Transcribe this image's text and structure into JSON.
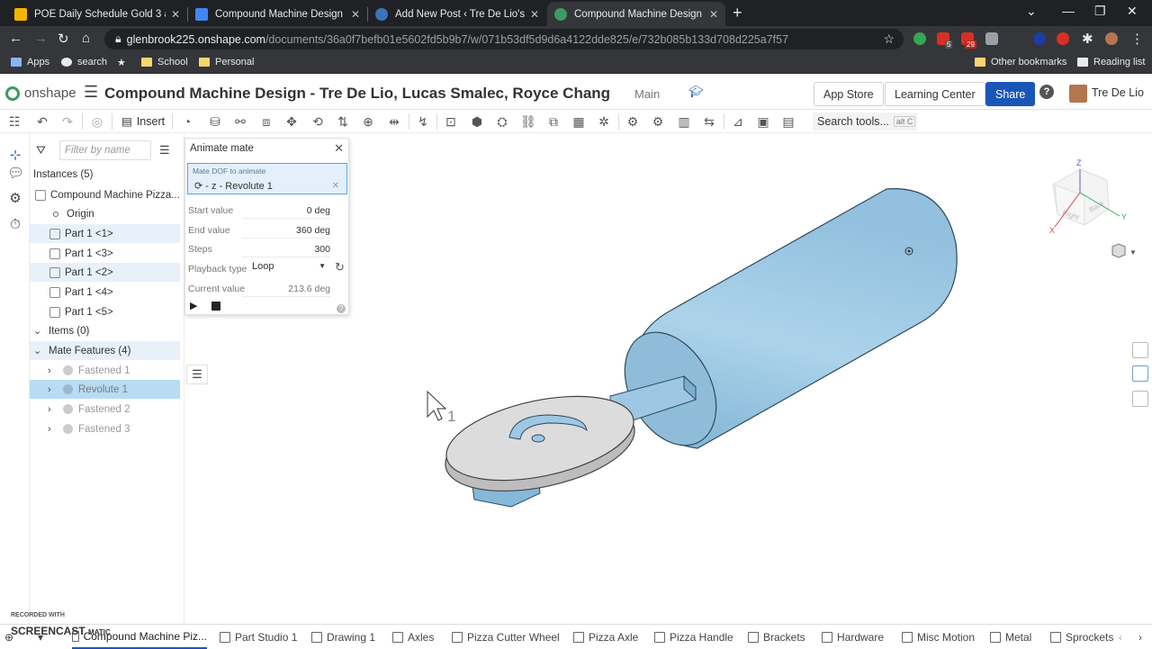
{
  "browser": {
    "tabs": [
      {
        "title": "POE Daily Schedule Gold 3 and C",
        "color": "#f4b400"
      },
      {
        "title": "Compound Machine Design with",
        "color": "#4285f4"
      },
      {
        "title": "Add New Post ‹ Tre De Lio's PLTW",
        "color": "#3b73b9"
      },
      {
        "title": "Compound Machine Design - Tre",
        "color": "#3d9a62"
      }
    ],
    "url_host": "glenbrook225.onshape.com",
    "url_path": "/documents/36a0f7befb01e5602fd5b9b7/w/071b53df5d9d6a4122dde825/e/732b085b133d708d225a7f57",
    "ext_badges": [
      "5",
      "29"
    ],
    "bookmarks": [
      "Apps",
      "search",
      "School",
      "Personal"
    ],
    "bookmarks_right": [
      "Other bookmarks",
      "Reading list"
    ]
  },
  "header": {
    "logo": "onshape",
    "title": "Compound Machine Design - Tre De Lio, Lucas Smalec, Royce Chang",
    "branch": "Main",
    "app_store": "App Store",
    "learning_center": "Learning Center",
    "share": "Share",
    "help": "?",
    "user": "Tre De Lio"
  },
  "toolbar": {
    "insert": "Insert",
    "search": "Search tools...",
    "search_kbd": "alt C"
  },
  "tree": {
    "filter_placeholder": "Filter by name",
    "instances_header": "Instances (5)",
    "assembly": "Compound Machine Pizza...",
    "origin": "Origin",
    "parts": [
      "Part 1 <1>",
      "Part 1 <3>",
      "Part 1 <2>",
      "Part 1 <4>",
      "Part 1 <5>"
    ],
    "items_header": "Items (0)",
    "mates_header": "Mate Features (4)",
    "mates": [
      "Fastened 1",
      "Revolute 1",
      "Fastened 2",
      "Fastened 3"
    ]
  },
  "animate": {
    "title": "Animate mate",
    "dof_label": "Mate DOF to animate",
    "dof_value": "- z - Revolute 1",
    "start_label": "Start value",
    "start_value": "0 deg",
    "end_label": "End value",
    "end_value": "360 deg",
    "steps_label": "Steps",
    "steps_value": "300",
    "playback_label": "Playback type",
    "playback_value": "Loop",
    "current_label": "Current value",
    "current_value": "213.6 deg"
  },
  "viewcube": {
    "top": "Z",
    "right_face": "Right",
    "back_face": "Back",
    "x": "X",
    "y": "Y"
  },
  "cursor_badge": "1",
  "bottom_tabs": [
    "Compound Machine Piz...",
    "Part Studio 1",
    "Drawing 1",
    "Axles",
    "Pizza Cutter Wheel",
    "Pizza Axle",
    "Pizza Handle",
    "Brackets",
    "Hardware",
    "Misc Motion",
    "Metal",
    "Sprockets"
  ],
  "watermark": {
    "line1": "RECORDED WITH",
    "line2": "SCREENCAST",
    "line3": "MATIC"
  },
  "colors": {
    "part_blue": "#a9cfe6",
    "wheel_gray": "#d6d6d6",
    "accent": "#1a56b8"
  }
}
